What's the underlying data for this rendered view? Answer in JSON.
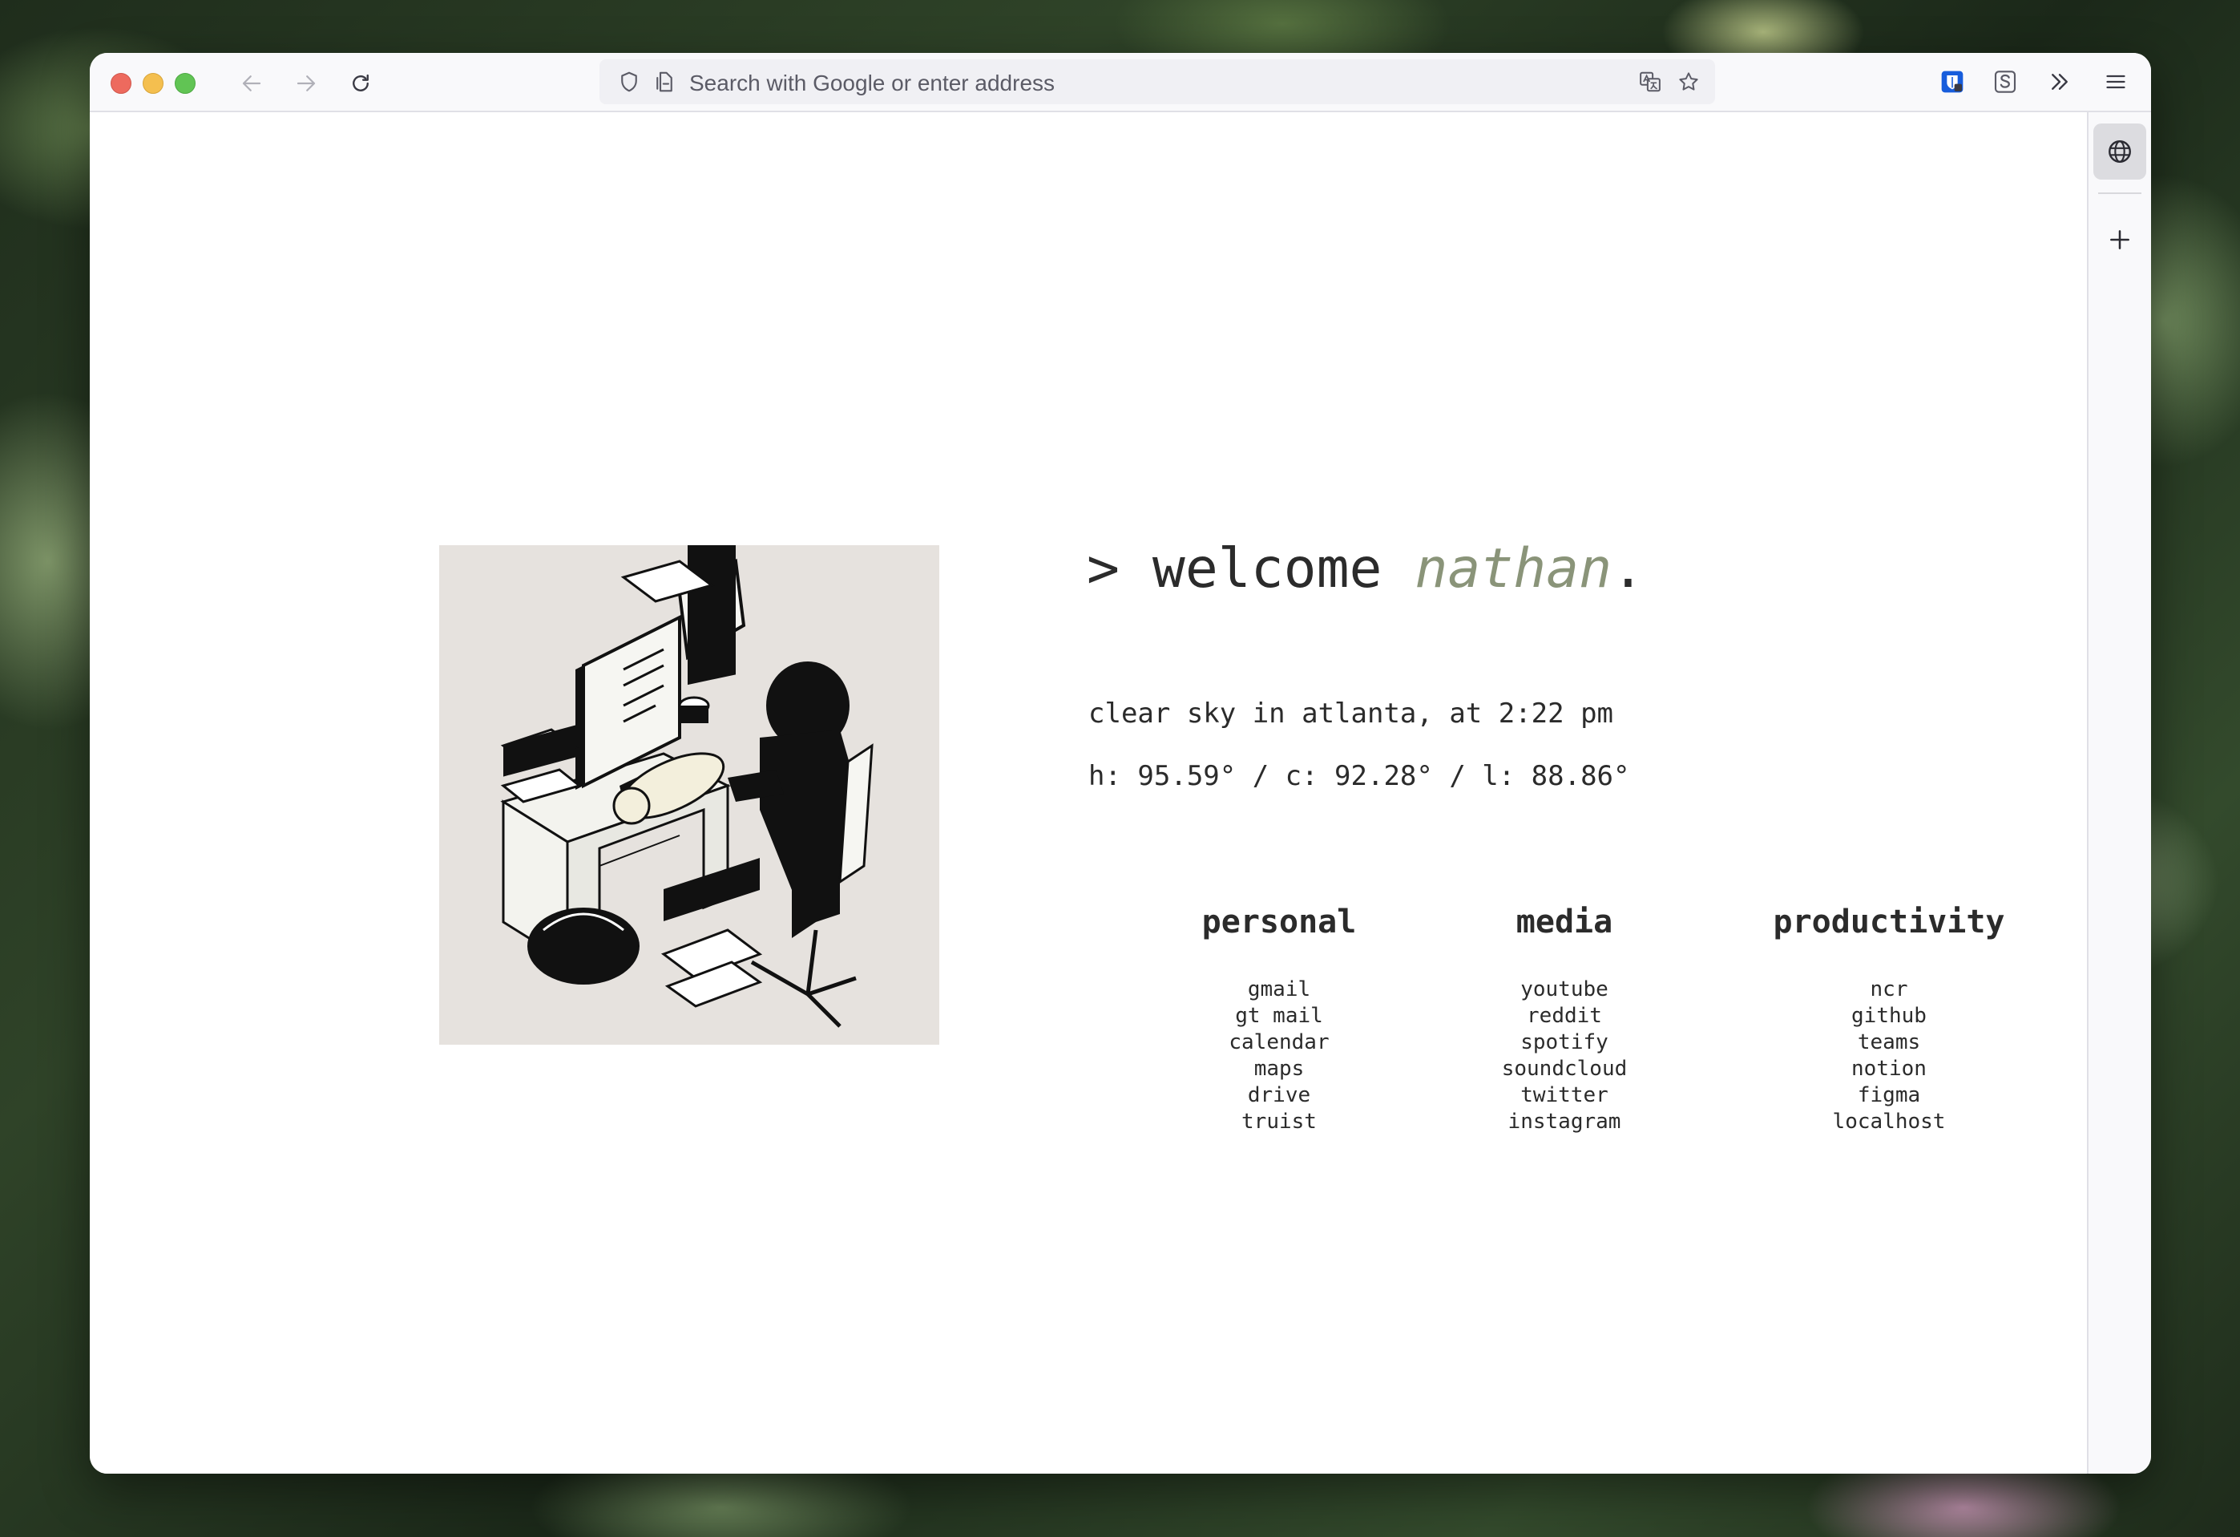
{
  "browser": {
    "url_placeholder": "Search with Google or enter address"
  },
  "page": {
    "welcome_prefix": "> welcome ",
    "welcome_name": "nathan",
    "welcome_suffix": ".",
    "weather_line": "clear sky in atlanta, at 2:22 pm",
    "temps_line": "h: 95.59° / c: 92.28° / l: 88.86°",
    "accent_color": "#8a9479"
  },
  "links": {
    "personal": {
      "title": "personal",
      "items": [
        "gmail",
        "gt mail",
        "calendar",
        "maps",
        "drive",
        "truist"
      ]
    },
    "media": {
      "title": "media",
      "items": [
        "youtube",
        "reddit",
        "spotify",
        "soundcloud",
        "twitter",
        "instagram"
      ]
    },
    "productivity": {
      "title": "productivity",
      "items": [
        "ncr",
        "github",
        "teams",
        "notion",
        "figma",
        "localhost"
      ]
    }
  },
  "icons": {
    "url_left": [
      "shield-icon",
      "page-permissions-icon"
    ],
    "url_right": [
      "translate-icon",
      "bookmark-star-icon"
    ],
    "toolbar_right": [
      "extension-bitwarden-icon",
      "extension-s-icon",
      "overflow-chevrons-icon",
      "hamburger-menu-icon"
    ],
    "sidebar": [
      "globe-icon",
      "plus-icon"
    ]
  }
}
